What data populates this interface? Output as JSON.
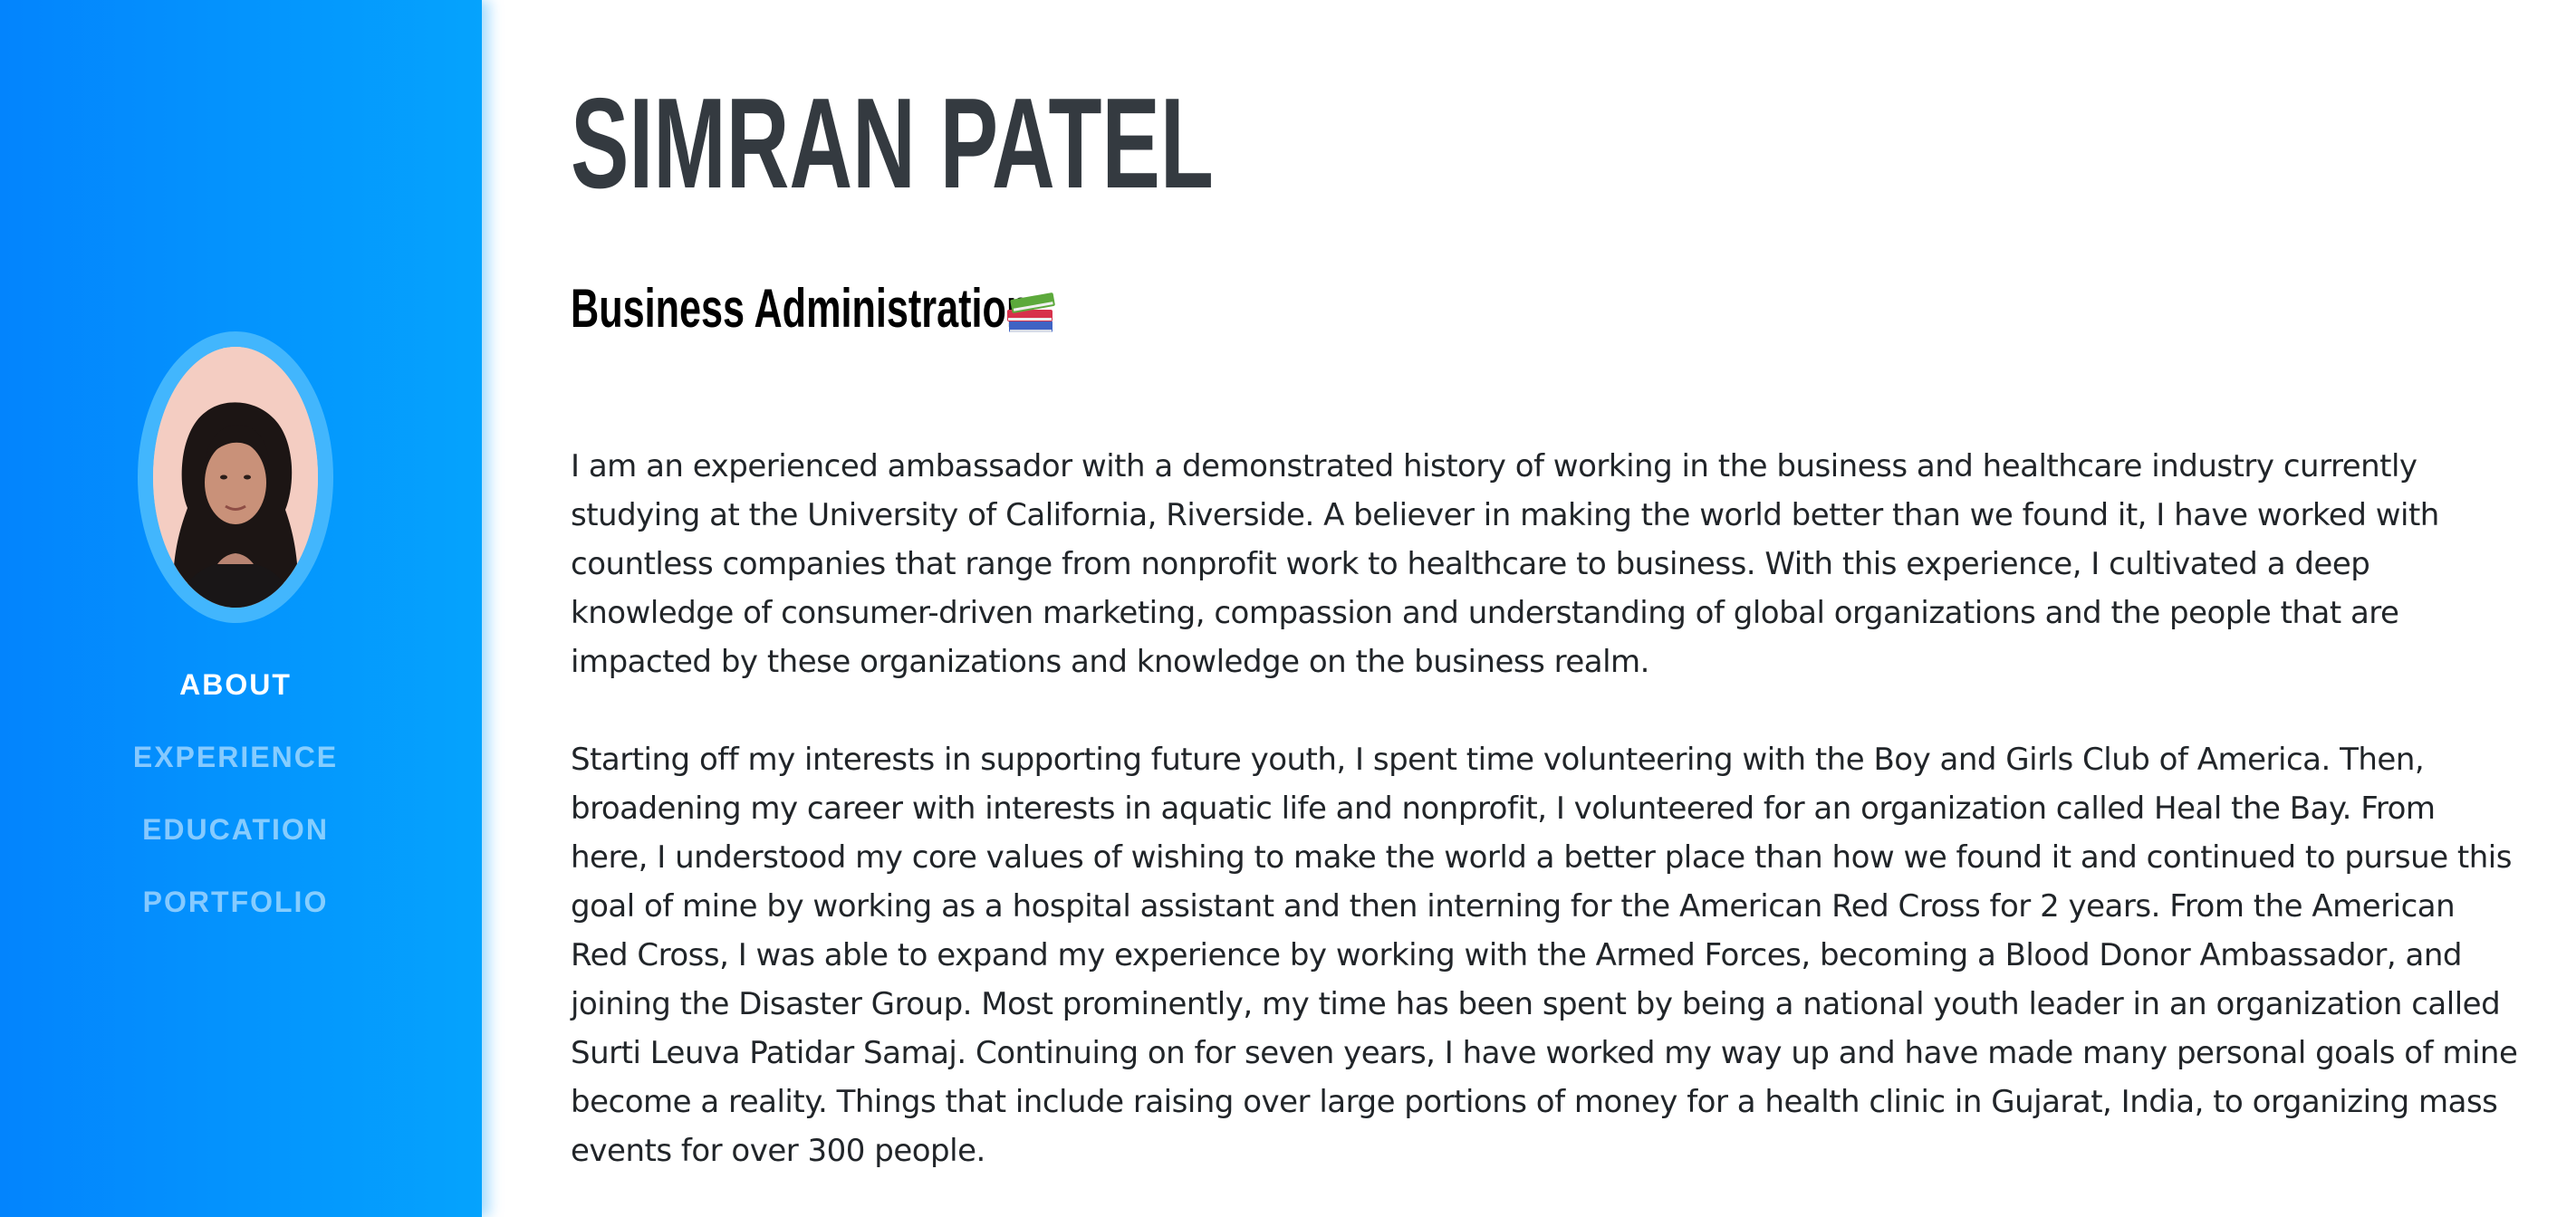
{
  "profile": {
    "name": "SIMRAN PATEL",
    "major": "Business Administration",
    "major_icon": "books-icon"
  },
  "nav": {
    "items": [
      {
        "label": "ABOUT",
        "active": true
      },
      {
        "label": "EXPERIENCE",
        "active": false
      },
      {
        "label": "EDUCATION",
        "active": false
      },
      {
        "label": "PORTFOLIO",
        "active": false
      }
    ]
  },
  "about": {
    "paragraphs": [
      "I am an experienced ambassador with a demonstrated history of working in the business and healthcare industry currently studying at the University of California, Riverside. A believer in making the world better than we found it, I have worked with countless companies that range from nonprofit work to healthcare to business. With this experience, I cultivated a deep knowledge of consumer-driven marketing, compassion and understanding of global organizations and the people that are impacted by these organizations and knowledge on the business realm.",
      "Starting off my interests in supporting future youth, I spent time volunteering with the Boy and Girls Club of America. Then, broadening my career with interests in aquatic life and nonprofit, I volunteered for an organization called Heal the Bay. From here, I understood my core values of wishing to make the world a better place than how we found it and continued to pursue this goal of mine by working as a hospital assistant and then interning for the American Red Cross for 2 years. From the American Red Cross, I was able to expand my experience by working with the Armed Forces, becoming a Blood Donor Ambassador, and joining the Disaster Group. Most prominently, my time has been spent by being a national youth leader in an organization called Surti Leuva Patidar Samaj. Continuing on for seven years, I have worked my way up and have made many personal goals of mine become a reality. Things that include raising over large portions of money for a health clinic in Gujarat, India, to organizing mass events for over 300 people."
    ]
  },
  "colors": {
    "sidebar_start": "#0384fd",
    "sidebar_end": "#05a3fd",
    "heading": "#343a40",
    "body_text": "#212529",
    "nav_active": "#ffffff",
    "nav_inactive": "#a6d8fe"
  }
}
